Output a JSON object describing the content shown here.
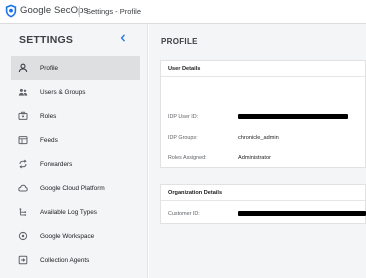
{
  "header": {
    "brand": "Google SecOps",
    "breadcrumb": "Settings - Profile"
  },
  "sidebar": {
    "title": "SETTINGS",
    "items": [
      {
        "label": "Profile",
        "icon": "person-icon",
        "active": true
      },
      {
        "label": "Users & Groups",
        "icon": "users-groups-icon",
        "active": false
      },
      {
        "label": "Roles",
        "icon": "roles-icon",
        "active": false
      },
      {
        "label": "Feeds",
        "icon": "feeds-icon",
        "active": false
      },
      {
        "label": "Forwarders",
        "icon": "forwarders-icon",
        "active": false
      },
      {
        "label": "Google Cloud Platform",
        "icon": "cloud-icon",
        "active": false
      },
      {
        "label": "Available Log Types",
        "icon": "log-types-icon",
        "active": false
      },
      {
        "label": "Google Workspace",
        "icon": "workspace-icon",
        "active": false
      },
      {
        "label": "Collection Agents",
        "icon": "collection-agents-icon",
        "active": false
      }
    ]
  },
  "main": {
    "title": "PROFILE",
    "user_details": {
      "heading": "User Details",
      "idp_user_id_label": "IDP User ID:",
      "idp_groups_label": "IDP Groups:",
      "idp_groups_value": "chronicle_admin",
      "roles_label": "Roles Assigned:",
      "roles_value": "Administrator"
    },
    "org_details": {
      "heading": "Organization Details",
      "customer_id_label": "Customer ID:"
    }
  },
  "colors": {
    "sidebar_bg": "#f4f5f7",
    "active_item_bg": "#dedfe1",
    "accent_blue": "#1a73e8",
    "redaction": "#000000"
  }
}
